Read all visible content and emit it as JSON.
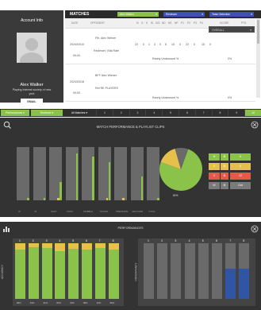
{
  "account": {
    "title": "Account Info",
    "name": "Alex Walker",
    "club": "Playing Interest society of new york",
    "email_label": "EMAIL"
  },
  "matches": {
    "title": "MATCHES",
    "filters": [
      {
        "label": "Alex Walker",
        "color": "#8bc34a"
      },
      {
        "label": "Reviewer",
        "color": "#3f51b5"
      },
      {
        "label": "Team Selection",
        "color": "#3f51b5"
      }
    ],
    "columns": [
      "DATE",
      "OPPONENT",
      "M",
      "G",
      "S",
      "W",
      "G/S",
      "ND",
      "NS",
      "NP",
      "P1",
      "P2",
      "P3",
      "P4",
      "SCORE",
      "PTS"
    ],
    "rows": [
      {
        "date": "2024/03/10",
        "time": "09:00",
        "player1": "Fth. Alex Weiner",
        "player2": "Reviewer, Villa Rafe",
        "note": "Rarely Underused %",
        "pct": "0%",
        "stats": [
          "22",
          "0",
          "1",
          "3",
          "0",
          "8",
          "15",
          "0",
          "22",
          "0",
          "15",
          "0"
        ]
      },
      {
        "date": "2024/03/18",
        "time": "09:00",
        "player1": "BFF Alex Wiener",
        "player2": "Ref RE PLAYERS",
        "note": "Rarely Underused %",
        "pct": "0%",
        "stats": []
      }
    ]
  },
  "filterbar": {
    "items": [
      "Performances",
      "Reviewer",
      "All Matches"
    ],
    "numbers": [
      "1",
      "2",
      "3",
      "4",
      "5",
      "6",
      "7",
      "8",
      "9",
      "10"
    ]
  },
  "performance": {
    "title": "MATCH PERFORMANCE & PLAYLIST CLIPS",
    "dropdown": "OVERALL",
    "pie_label": "61%",
    "pie_values": {
      "green": 0.75,
      "yellow": 0.15,
      "grey": 0.1
    },
    "bars": [
      {
        "label": "W",
        "green": 0.05,
        "yellow": 0.0
      },
      {
        "label": "W",
        "green": 0.05,
        "yellow": 0.0
      },
      {
        "label": "SHOT",
        "green": 0.35,
        "yellow": 0.05
      },
      {
        "label": "PASS",
        "green": 0.88,
        "yellow": 0.0
      },
      {
        "label": "DRIBBLE",
        "green": 0.82,
        "yellow": 0.0
      },
      {
        "label": "TACKLE",
        "green": 0.72,
        "yellow": 0.05
      },
      {
        "label": "PRESSURE",
        "green": 0.0,
        "yellow": 0.04
      },
      {
        "label": "RECOVER",
        "green": 0.45,
        "yellow": 0.0
      },
      {
        "label": "TOTAL",
        "green": 0.05,
        "yellow": 0.0
      }
    ],
    "legend": [
      {
        "letter": "N",
        "value": "6",
        "color": "#8bc34a"
      },
      {
        "letter": "S",
        "value": "4",
        "color": "#e6c04a"
      },
      {
        "letter": "C",
        "value": "12",
        "color": "#e45a4a"
      },
      {
        "letter": "W",
        "value": "Out",
        "color": "#7a7a7a"
      }
    ]
  },
  "performances": {
    "title": "PERFORMANCES",
    "left_ylabel": "ACCURACY",
    "right_ylabel": "CONSISTENCY",
    "left_bars": [
      {
        "num": "1",
        "pct": "88%",
        "green": 0.88
      },
      {
        "num": "2",
        "pct": "93%",
        "green": 0.93
      },
      {
        "num": "3",
        "pct": "91%",
        "green": 0.91
      },
      {
        "num": "4",
        "pct": "86%",
        "green": 0.86
      },
      {
        "num": "5",
        "pct": "90%",
        "green": 0.9
      },
      {
        "num": "6",
        "pct": "88%",
        "green": 0.88
      },
      {
        "num": "7",
        "pct": "92%",
        "green": 0.92
      },
      {
        "num": "8",
        "pct": "89%",
        "green": 0.89
      }
    ],
    "right_bars": [
      {
        "num": "1",
        "blue": 0.0
      },
      {
        "num": "2",
        "blue": 0.0
      },
      {
        "num": "3",
        "blue": 0.0
      },
      {
        "num": "4",
        "blue": 0.0
      },
      {
        "num": "5",
        "blue": 0.0
      },
      {
        "num": "6",
        "blue": 0.0
      },
      {
        "num": "7",
        "blue": 0.55
      },
      {
        "num": "8",
        "blue": 0.55
      }
    ]
  }
}
